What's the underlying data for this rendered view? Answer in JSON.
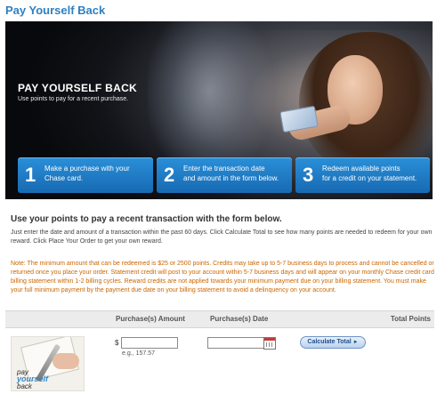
{
  "page": {
    "title": "Pay Yourself Back"
  },
  "hero": {
    "title": "PAY YOURSELF BACK",
    "subtitle": "Use points to pay for a recent purchase.",
    "steps": [
      {
        "number": "1",
        "text_line1": "Make a purchase with your",
        "text_line2": "Chase card."
      },
      {
        "number": "2",
        "text_line1": "Enter the transaction date",
        "text_line2": "and amount in the form below."
      },
      {
        "number": "3",
        "text_line1": "Redeem available points",
        "text_line2": "for a credit on your statement."
      }
    ]
  },
  "form_section": {
    "heading": "Use your points to pay a recent transaction with the form below.",
    "intro": "Just enter the date and amount of a transaction within the past 60 days. Click Calculate Total to see how many points are needed to redeem for your own reward. Click Place Your Order to get your own reward.",
    "note": "Note: The minimum amount that can be redeemed is $25 or 2500 points. Credits may take up to 5-7 business days to process and cannot be cancelled or returned once you place your order. Statement credit will post to your account within 5-7 business days and will appear on your monthly Chase credit card billing statement within 1-2 billing cycles. Reward credits are not applied towards your minimum payment due on your billing statement. You must make your full minimum payment by the payment due date on your billing statement to avoid a delinquency on your account."
  },
  "table": {
    "headers": {
      "amount": "Purchase(s) Amount",
      "date": "Purchase(s) Date",
      "points": "Total Points"
    },
    "row": {
      "thumbnail_text": {
        "line1": "pay",
        "line2": "yourself",
        "line3": "back"
      },
      "currency_symbol": "$",
      "amount_value": "",
      "amount_example": "e.g., 157.57",
      "date_value": "",
      "calculate_label": "Calculate Total",
      "calculate_arrow": "►"
    }
  },
  "colors": {
    "title_blue": "#2f7fc1",
    "step_blue": "#1f7cc6",
    "note_orange": "#cc6600"
  }
}
